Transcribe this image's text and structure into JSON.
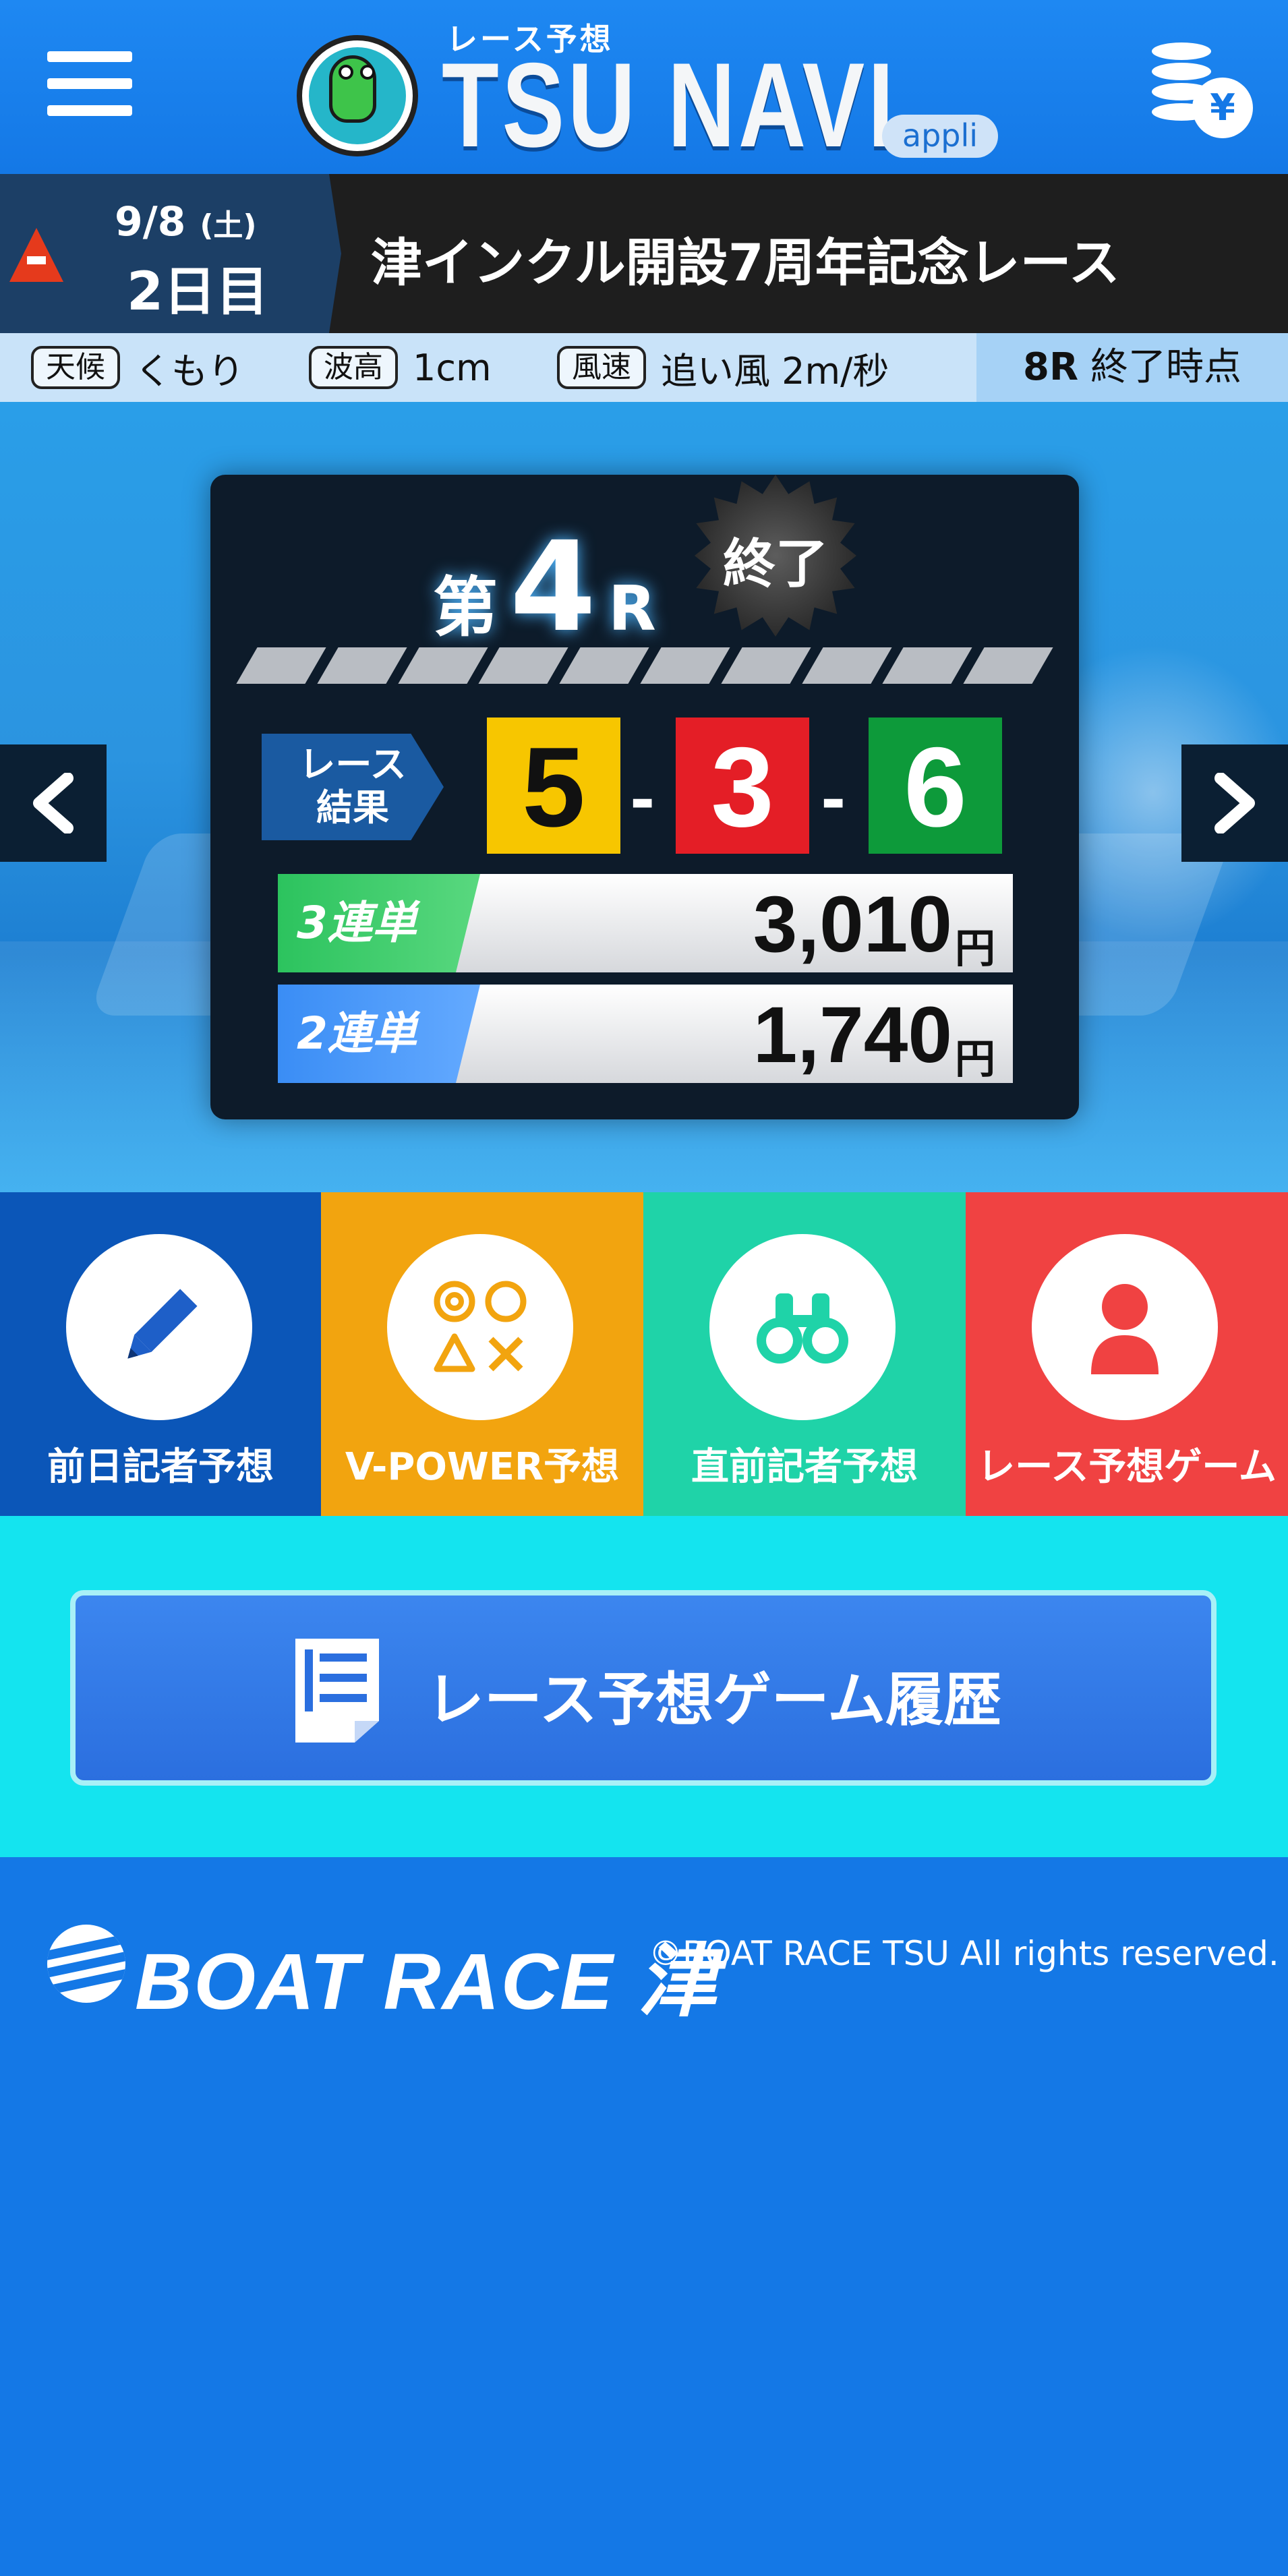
{
  "header": {
    "logo_subtitle": "レース予想",
    "logo_title": "TSU NAVI",
    "logo_badge": "appli",
    "coin_icon_glyph": "¥"
  },
  "event": {
    "date": "9/8",
    "weekday": "(土)",
    "day_number": "2日目",
    "title": "津インクル開設7周年記念レース"
  },
  "weather": {
    "weather_tag": "天候",
    "weather_value": "くもり",
    "wave_tag": "波高",
    "wave_value": "1cm",
    "wind_tag": "風速",
    "wind_value": "追い風 2m/秒",
    "status_race": "8R",
    "status_text": "終了時点"
  },
  "race": {
    "prefix": "第",
    "number": "4",
    "suffix": "R",
    "end_badge": "終了",
    "result_tag_line1": "レース",
    "result_tag_line2": "結果",
    "result": [
      "5",
      "3",
      "6"
    ],
    "dash": "-",
    "payouts": [
      {
        "label": "3連単",
        "amount": "3,010",
        "unit": "円"
      },
      {
        "label": "2連単",
        "amount": "1,740",
        "unit": "円"
      }
    ]
  },
  "tiles": [
    {
      "label": "前日記者予想",
      "icon": "pencil-icon",
      "color": "#0b56b8"
    },
    {
      "label": "V-POWER予想",
      "icon": "shapes-icon",
      "color": "#f2a40f"
    },
    {
      "label": "直前記者予想",
      "icon": "binoculars-icon",
      "color": "#1fd3a8"
    },
    {
      "label": "レース予想ゲーム",
      "icon": "person-icon",
      "color": "#f04242"
    }
  ],
  "history": {
    "label": "レース予想ゲーム履歴",
    "icon": "document-icon"
  },
  "footer": {
    "brand": "BOAT RACE 津",
    "copyright": "©BOAT RACE TSU All rights reserved."
  }
}
